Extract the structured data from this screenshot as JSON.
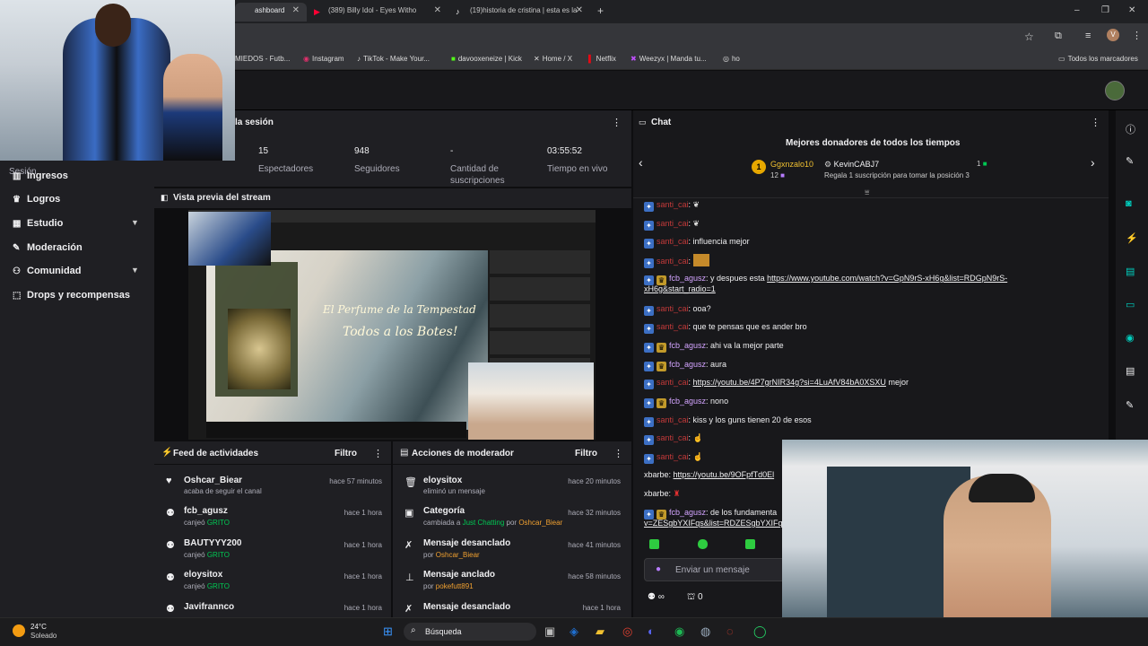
{
  "browser": {
    "tabs": [
      {
        "title": "ashboard",
        "icon": "twitch-icon"
      },
      {
        "title": "(389) Billy Idol - Eyes Witho",
        "icon": "youtube-icon"
      },
      {
        "title": "(19)historia de cristina | esta es la",
        "icon": "tiktok-icon"
      }
    ],
    "new_tab": "+",
    "window_controls": [
      "–",
      "❐",
      "✕"
    ],
    "bookmarks": [
      {
        "label": "MIEDOS - Futb..."
      },
      {
        "label": "Instagram"
      },
      {
        "label": "TikTok - Make Your..."
      },
      {
        "label": "davooxeneize | Kick"
      },
      {
        "label": "Home / X"
      },
      {
        "label": "Netflix"
      },
      {
        "label": "Weezyx | Manda tu..."
      },
      {
        "label": "ho"
      }
    ],
    "all_bookmarks": "Todos los marcadores",
    "profile_initial": "V"
  },
  "session": {
    "title": "la sesión",
    "sidebar_label": "Sesión",
    "stats": [
      {
        "value": "15",
        "label": "Espectadores"
      },
      {
        "value": "948",
        "label": "Seguidores"
      },
      {
        "value": "-",
        "label": "Cantidad de suscripciones"
      },
      {
        "value": "03:55:52",
        "label": "Tiempo en vivo"
      }
    ]
  },
  "nav": {
    "items": [
      {
        "label": "Ingresos",
        "icon": "chart-icon",
        "expandable": false
      },
      {
        "label": "Logros",
        "icon": "trophy-icon",
        "expandable": false
      },
      {
        "label": "Estudio",
        "icon": "studio-icon",
        "expandable": true
      },
      {
        "label": "Moderación",
        "icon": "wrench-icon",
        "expandable": false
      },
      {
        "label": "Comunidad",
        "icon": "community-icon",
        "expandable": true
      },
      {
        "label": "Drops y recompensas",
        "icon": "gift-icon",
        "expandable": false
      }
    ]
  },
  "preview": {
    "title": "Vista previa del stream",
    "overlay_line1": "El Perfume de la Tempestad",
    "overlay_line2": "Todos a los Botes!"
  },
  "activity_feed": {
    "title": "Feed de actividades",
    "filter": "Filtro",
    "items": [
      {
        "name": "Oshcar_Biear",
        "sub": "acaba de seguir el canal",
        "sub_hl": "",
        "time": "hace 57 minutos",
        "icon": "heart-icon"
      },
      {
        "name": "fcb_agusz",
        "sub": "canjeó",
        "sub_hl": "GRITO",
        "time": "hace 1 hora",
        "icon": "points-icon"
      },
      {
        "name": "BAUTYYY200",
        "sub": "canjeó",
        "sub_hl": "GRITO",
        "time": "hace 1 hora",
        "icon": "points-icon"
      },
      {
        "name": "eloysitox",
        "sub": "canjeó",
        "sub_hl": "GRITO",
        "time": "hace 1 hora",
        "icon": "points-icon"
      },
      {
        "name": "Javifrannco",
        "sub": "",
        "sub_hl": "",
        "time": "hace 1 hora",
        "icon": "points-icon"
      }
    ]
  },
  "mod_actions": {
    "title": "Acciones de moderador",
    "filter": "Filtro",
    "items": [
      {
        "name": "eloysitox",
        "sub_pre": "eliminó un mensaje",
        "sub_hl": "",
        "sub_mid": "",
        "sub_by": "",
        "time": "hace 20 minutos",
        "icon": "trash-icon"
      },
      {
        "name": "Categoría",
        "sub_pre": "cambiada a",
        "sub_hl": "Just Chatting",
        "sub_mid": "por",
        "sub_by": "Oshcar_Biear",
        "time": "hace 32 minutos",
        "icon": "category-icon"
      },
      {
        "name": "Mensaje desanclado",
        "sub_pre": "por",
        "sub_hl": "",
        "sub_mid": "",
        "sub_by": "Oshcar_Biear",
        "time": "hace 41 minutos",
        "icon": "unpin-icon"
      },
      {
        "name": "Mensaje anclado",
        "sub_pre": "por",
        "sub_hl": "",
        "sub_mid": "",
        "sub_by": "pokefutt891",
        "time": "hace 58 minutos",
        "icon": "pin-icon"
      },
      {
        "name": "Mensaje desanclado",
        "sub_pre": "",
        "sub_hl": "",
        "sub_mid": "",
        "sub_by": "",
        "time": "hace 1 hora",
        "icon": "unpin-icon"
      }
    ]
  },
  "chat": {
    "title": "Chat",
    "top_donors_title": "Mejores donadores de todos los tiempos",
    "donor1": {
      "name": "Ggxnzalo10",
      "amount": "12",
      "rank": "1"
    },
    "donor2": {
      "name": "KevinCABJ7",
      "amount": "1"
    },
    "donor_hint": "Regala 1 suscripción para tomar la posición 3",
    "messages": [
      {
        "user": "santi_cai",
        "text": "",
        "badges": [
          "blue"
        ],
        "style": "s"
      },
      {
        "user": "santi_cai",
        "text": "",
        "badges": [
          "blue"
        ],
        "style": "s"
      },
      {
        "user": "santi_cai",
        "text": "influencia mejor",
        "badges": [
          "blue"
        ],
        "style": "s"
      },
      {
        "user": "santi_cai",
        "text": "",
        "badges": [
          "blue"
        ],
        "style": "s"
      },
      {
        "user": "fcb_agusz",
        "text": "y despues esta",
        "link": "https://www.youtube.com/watch?v=GpN9rS-xH6g&list=RDGpN9rS-",
        "link2": "xH6g&start_radio=1",
        "badges": [
          "blue",
          "gold"
        ],
        "style": "f"
      },
      {
        "user": "santi_cai",
        "text": "ooa?",
        "badges": [
          "blue"
        ],
        "style": "s"
      },
      {
        "user": "santi_cai",
        "text": "que te pensas que es ander bro",
        "badges": [
          "blue"
        ],
        "style": "s"
      },
      {
        "user": "fcb_agusz",
        "text": "ahi va la mejor parte",
        "badges": [
          "blue",
          "gold"
        ],
        "style": "f"
      },
      {
        "user": "fcb_agusz",
        "text": "aura",
        "badges": [
          "blue",
          "gold"
        ],
        "style": "f"
      },
      {
        "user": "santi_cai",
        "text": "mejor",
        "link": "https://youtu.be/4P7grNIR34g?si=4LuAfV84bA0XSXU",
        "badges": [
          "blue"
        ],
        "style": "s"
      },
      {
        "user": "fcb_agusz",
        "text": "nono",
        "badges": [
          "blue",
          "gold"
        ],
        "style": "f"
      },
      {
        "user": "santi_cai",
        "text": "kiss y los guns tienen 20 de esos",
        "badges": [
          "blue"
        ],
        "style": "s"
      },
      {
        "user": "santi_cai",
        "text": "",
        "badges": [
          "blue"
        ],
        "style": "s"
      },
      {
        "user": "santi_cai",
        "text": "",
        "badges": [
          "blue"
        ],
        "style": "s"
      },
      {
        "user": "xbarbe",
        "text": "",
        "link": "https://youtu.be/9OFpfTd0El",
        "badges": [],
        "style": "x"
      },
      {
        "user": "xbarbe",
        "text": "",
        "badges": [],
        "style": "x"
      },
      {
        "user": "fcb_agusz",
        "text": "de los fundamenta",
        "link2": "v=ZESgbYXIFqs&list=RDZESgbYXIFqs",
        "badges": [
          "blue",
          "gold"
        ],
        "style": "f"
      }
    ],
    "input_placeholder": "Enviar un mensaje",
    "points": "0",
    "infinite": "∞"
  },
  "taskbar": {
    "weather_temp": "24°C",
    "weather_desc": "Soleado",
    "search_label": "Búsqueda"
  },
  "colors": {
    "accent_green": "#00c853",
    "chat_red": "#c43a3a",
    "chat_purple": "#d3a4ff",
    "bg_panel": "#1f1f23"
  }
}
